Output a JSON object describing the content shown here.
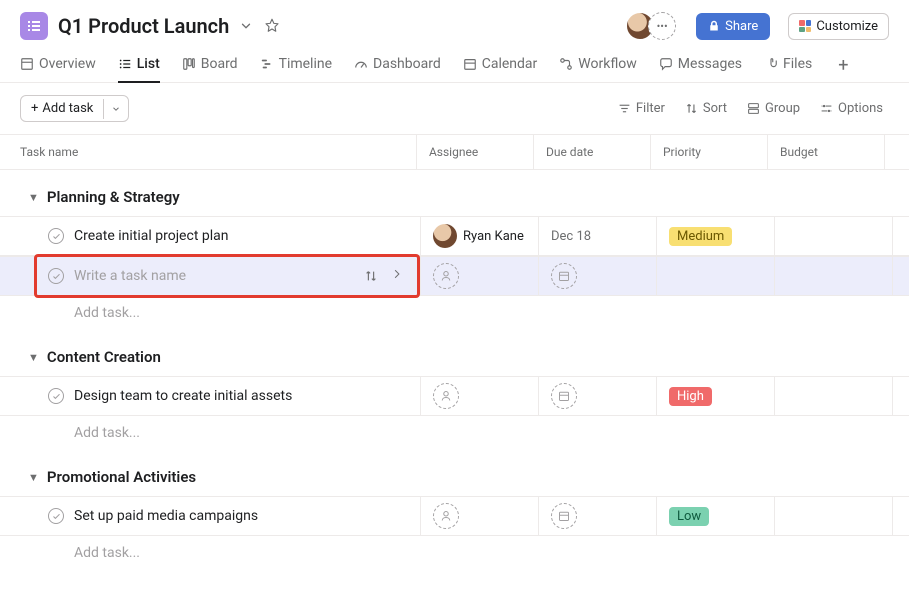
{
  "header": {
    "title": "Q1 Product Launch",
    "share_label": "Share",
    "customize_label": "Customize"
  },
  "tabs": [
    {
      "id": "overview",
      "label": "Overview"
    },
    {
      "id": "list",
      "label": "List"
    },
    {
      "id": "board",
      "label": "Board"
    },
    {
      "id": "timeline",
      "label": "Timeline"
    },
    {
      "id": "dashboard",
      "label": "Dashboard"
    },
    {
      "id": "calendar",
      "label": "Calendar"
    },
    {
      "id": "workflow",
      "label": "Workflow"
    },
    {
      "id": "messages",
      "label": "Messages"
    },
    {
      "id": "files",
      "label": "Files"
    }
  ],
  "toolbar": {
    "add_task_label": "Add task",
    "filter_label": "Filter",
    "sort_label": "Sort",
    "group_label": "Group",
    "options_label": "Options"
  },
  "columns": {
    "name": "Task name",
    "assignee": "Assignee",
    "due": "Due date",
    "priority": "Priority",
    "budget": "Budget"
  },
  "sections": [
    {
      "id": "planning",
      "title": "Planning & Strategy",
      "tasks": [
        {
          "name": "Create initial project plan",
          "assignee": "Ryan Kane",
          "due": "Dec 18",
          "priority": "Medium",
          "priority_class": "pill-medium"
        }
      ],
      "new_task_placeholder": "Write a task name",
      "add_label": "Add task..."
    },
    {
      "id": "content",
      "title": "Content Creation",
      "tasks": [
        {
          "name": "Design team to create initial assets",
          "assignee": "",
          "due": "",
          "priority": "High",
          "priority_class": "pill-high"
        }
      ],
      "add_label": "Add task..."
    },
    {
      "id": "promo",
      "title": "Promotional Activities",
      "tasks": [
        {
          "name": "Set up paid media campaigns",
          "assignee": "",
          "due": "",
          "priority": "Low",
          "priority_class": "pill-low"
        }
      ],
      "add_label": "Add task..."
    }
  ]
}
